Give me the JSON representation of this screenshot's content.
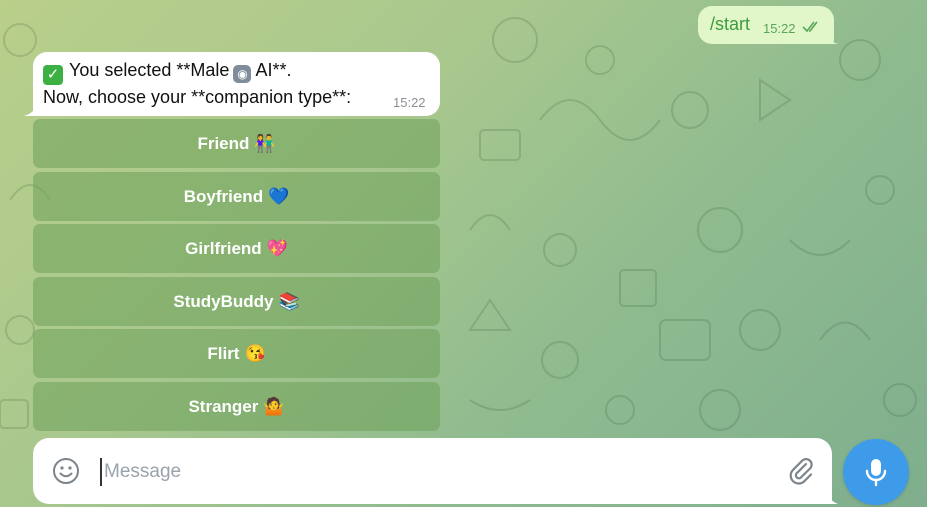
{
  "chat": {
    "outgoing": {
      "text": "/start",
      "time": "15:22"
    },
    "incoming": {
      "line1_before": "You selected **Male",
      "line1_after": "AI**.",
      "line2": "Now, choose your **companion type**:",
      "time": "15:22",
      "check_emoji": "✓",
      "robot_emoji": "◉"
    }
  },
  "keyboard": {
    "buttons": [
      {
        "label": "Friend",
        "emoji": "👫"
      },
      {
        "label": "Boyfriend",
        "emoji": "💙"
      },
      {
        "label": "Girlfriend",
        "emoji": "💖"
      },
      {
        "label": "StudyBuddy",
        "emoji": "📚"
      },
      {
        "label": "Flirt",
        "emoji": "😘"
      },
      {
        "label": "Stranger",
        "emoji": "🤷"
      }
    ]
  },
  "composer": {
    "placeholder": "Message"
  },
  "icons": {
    "emoji": "smile-icon",
    "attach": "paperclip-icon",
    "send": "microphone-icon",
    "read": "double-check-icon"
  },
  "colors": {
    "outgoing_bubble": "#e1f7c9",
    "accent": "#3d9be9",
    "keyboard_button": "#6ea05a"
  }
}
